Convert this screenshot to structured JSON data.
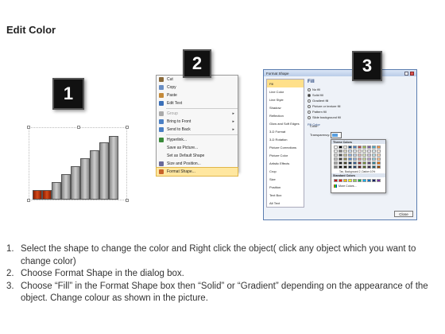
{
  "page": {
    "title": "Edit Color"
  },
  "badges": [
    "1",
    "2",
    "3"
  ],
  "context_menu": {
    "items": [
      {
        "label": "Cut",
        "icon": "scissors-icon",
        "color": "#8a6a3a",
        "selected": false,
        "disabled": false,
        "arrow": false
      },
      {
        "label": "Copy",
        "icon": "copy-icon",
        "color": "#6b8fc4",
        "selected": false,
        "disabled": false,
        "arrow": false
      },
      {
        "label": "Paste",
        "icon": "paste-icon",
        "color": "#c48a3a",
        "selected": false,
        "disabled": false,
        "arrow": false
      },
      {
        "label": "Edit Text",
        "icon": "text-icon",
        "color": "#3a6fb8",
        "selected": false,
        "disabled": false,
        "arrow": false
      },
      {
        "sep": true
      },
      {
        "label": "Group",
        "icon": "group-icon",
        "color": "#aaaaaa",
        "selected": false,
        "disabled": true,
        "arrow": true
      },
      {
        "label": "Bring to Front",
        "icon": "bring-front-icon",
        "color": "#4a7fc4",
        "selected": false,
        "disabled": false,
        "arrow": true
      },
      {
        "label": "Send to Back",
        "icon": "send-back-icon",
        "color": "#4a7fc4",
        "selected": false,
        "disabled": false,
        "arrow": true
      },
      {
        "sep": true
      },
      {
        "label": "Hyperlink...",
        "icon": "hyperlink-icon",
        "color": "#3a8a3a",
        "selected": false,
        "disabled": false,
        "arrow": false
      },
      {
        "label": "Save as Picture...",
        "icon": "",
        "color": "",
        "selected": false,
        "disabled": false,
        "arrow": false
      },
      {
        "label": "Set as Default Shape",
        "icon": "",
        "color": "",
        "selected": false,
        "disabled": false,
        "arrow": false
      },
      {
        "label": "Size and Position...",
        "icon": "size-icon",
        "color": "#6a6a9a",
        "selected": false,
        "disabled": false,
        "arrow": false
      },
      {
        "label": "Format Shape...",
        "icon": "format-shape-icon",
        "color": "#c8642a",
        "selected": true,
        "disabled": false,
        "arrow": false
      }
    ]
  },
  "dialog": {
    "title": "Format Shape",
    "left_items": [
      "Fill",
      "Line Color",
      "Line Style",
      "Shadow",
      "Reflection",
      "Glow and Soft Edges",
      "3-D Format",
      "3-D Rotation",
      "Picture Corrections",
      "Picture Color",
      "Artistic Effects",
      "Crop",
      "Size",
      "Position",
      "Text Box",
      "Alt Text"
    ],
    "selected_left": "Fill",
    "fill_heading": "Fill",
    "fill_options": [
      {
        "label": "No fill",
        "on": false
      },
      {
        "label": "Solid fill",
        "on": true
      },
      {
        "label": "Gradient fill",
        "on": false
      },
      {
        "label": "Picture or texture fill",
        "on": false
      },
      {
        "label": "Pattern fill",
        "on": false
      },
      {
        "label": "Slide background fill",
        "on": false
      }
    ],
    "fill_color_label": "Fill Color",
    "color_label": "Color:",
    "transparency_label": "Transparency:",
    "close_label": "Close"
  },
  "picker": {
    "theme_colors_label": "Theme Colors",
    "theme_rows": [
      [
        "#ffffff",
        "#000000",
        "#eeece1",
        "#1f497d",
        "#4f81bd",
        "#c0504d",
        "#9bbb59",
        "#8064a2",
        "#4bacc6",
        "#f79646"
      ],
      [
        "#f2f2f2",
        "#7f7f7f",
        "#ddd9c3",
        "#c6d9f0",
        "#dbe5f1",
        "#f2dcdb",
        "#ebf1dd",
        "#e5e0ec",
        "#dbeef3",
        "#fdeada"
      ],
      [
        "#d8d8d8",
        "#595959",
        "#c4bd97",
        "#8db3e2",
        "#b8cce4",
        "#e5b9b7",
        "#d7e3bc",
        "#ccc1d9",
        "#b7dde8",
        "#fbd5b5"
      ],
      [
        "#bfbfbf",
        "#3f3f3f",
        "#938953",
        "#548dd4",
        "#95b3d7",
        "#d99694",
        "#c3d69b",
        "#b2a2c7",
        "#92cddc",
        "#fac08f"
      ],
      [
        "#a5a5a5",
        "#262626",
        "#494429",
        "#17365d",
        "#366092",
        "#953734",
        "#76923c",
        "#5f497a",
        "#31859b",
        "#e36c09"
      ],
      [
        "#7f7f7f",
        "#0c0c0c",
        "#1d1b10",
        "#0f243e",
        "#244061",
        "#632423",
        "#4f6128",
        "#3f3151",
        "#205867",
        "#974806"
      ]
    ],
    "tooltip": "Tan, Background 2, Darker 10%",
    "standard_colors_label": "Standard Colors",
    "standard_row": [
      "#c00000",
      "#ff0000",
      "#ffc000",
      "#ffff00",
      "#92d050",
      "#00b050",
      "#00b0f0",
      "#0070c0",
      "#002060",
      "#7030a0"
    ],
    "more_colors_label": "More Colors..."
  },
  "steps": [
    {
      "num": "1.",
      "text": "Select the shape to change the color and Right click the object( click any object which you want to change color)"
    },
    {
      "num": "2.",
      "text": "Choose Format Shape in the dialog box."
    },
    {
      "num": "3.",
      "text": "Choose “Fill” in the Format Shape box then “Solid” or “Gradient” depending on the appearance of the object. Change colour as shown in the picture."
    }
  ]
}
